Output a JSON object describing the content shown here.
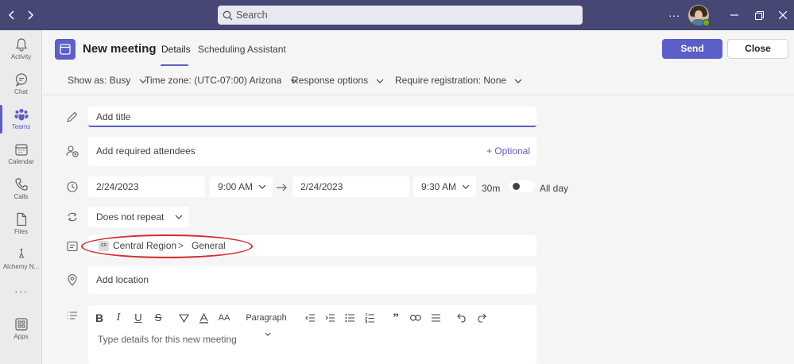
{
  "titlebar": {
    "search_placeholder": "Search",
    "more_label": "···"
  },
  "rail": {
    "items": [
      {
        "label": "Activity",
        "icon": "bell-icon"
      },
      {
        "label": "Chat",
        "icon": "chat-icon"
      },
      {
        "label": "Teams",
        "icon": "teams-icon",
        "active": true
      },
      {
        "label": "Calendar",
        "icon": "calendar-icon"
      },
      {
        "label": "Calls",
        "icon": "phone-icon"
      },
      {
        "label": "Files",
        "icon": "file-icon"
      },
      {
        "label": "Alchemy N...",
        "icon": "app-icon"
      },
      {
        "label": "···",
        "icon": "more-icon"
      },
      {
        "label": "Apps",
        "icon": "apps-icon"
      }
    ]
  },
  "header": {
    "title": "New meeting",
    "tabs": [
      {
        "label": "Details",
        "active": true
      },
      {
        "label": "Scheduling Assistant",
        "active": false
      }
    ],
    "send_label": "Send",
    "close_label": "Close"
  },
  "options": {
    "show_as": "Show as: Busy",
    "time_zone": "Time zone: (UTC-07:00) Arizona",
    "response": "Response options",
    "registration": "Require registration: None"
  },
  "form": {
    "title_placeholder": "Add title",
    "attendees_placeholder": "Add required attendees",
    "optional_label": "+ Optional",
    "start_date": "2/24/2023",
    "start_time": "9:00 AM",
    "end_date": "2/24/2023",
    "end_time": "9:30 AM",
    "duration": "30m",
    "all_day_label": "All day",
    "all_day_on": false,
    "repeat": "Does not repeat",
    "channel": {
      "badge": "CR",
      "team": "Central Region",
      "separator": ">",
      "channel": "General"
    },
    "location_placeholder": "Add location",
    "editor": {
      "paragraph_label": "Paragraph",
      "placeholder": "Type details for this new meeting"
    }
  },
  "colors": {
    "brand": "#5b5fc7",
    "titlebar": "#464775",
    "annotation": "#d32f2f"
  }
}
